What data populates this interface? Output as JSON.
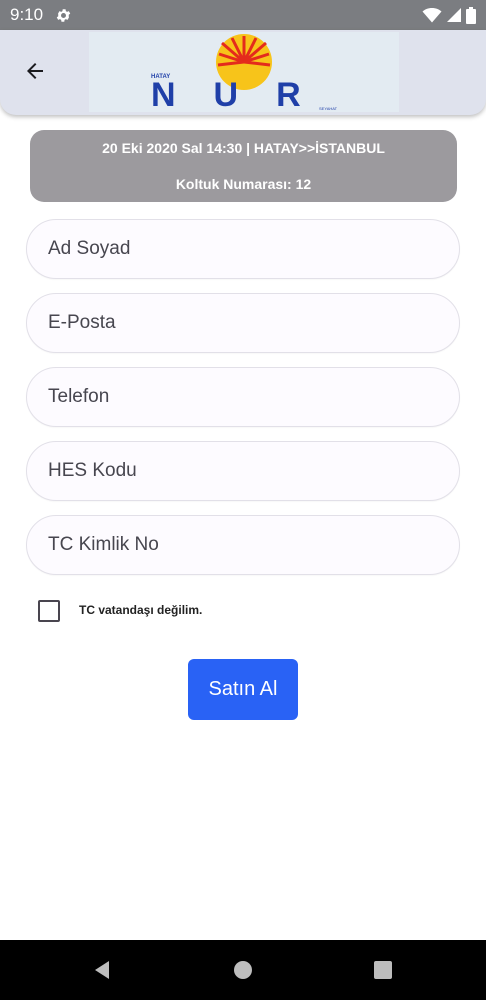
{
  "status_bar": {
    "time": "9:10",
    "icons": [
      "gear-icon",
      "wifi-icon",
      "signal-icon",
      "battery-icon"
    ]
  },
  "app_bar": {
    "back_icon": "arrow-left-icon",
    "logo": {
      "small_text_left": "HATAY",
      "brand": "NUR",
      "small_text_right": "SEYAHAT"
    }
  },
  "trip": {
    "line1": "20 Eki 2020 Sal 14:30 | HATAY>>İSTANBUL",
    "line2": "Koltuk Numarası: 12"
  },
  "form": {
    "name_placeholder": "Ad Soyad",
    "email_placeholder": "E-Posta",
    "phone_placeholder": "Telefon",
    "hes_placeholder": "HES Kodu",
    "tc_placeholder": "TC Kimlik No"
  },
  "checkbox": {
    "label": "TC vatandaşı değilim.",
    "checked": false
  },
  "buy_button": {
    "label": "Satın Al"
  },
  "colors": {
    "status_bar": "#7b7d81",
    "app_bar": "#dfe2ed",
    "trip_card": "#9c9a9e",
    "accent_button": "#2962f5",
    "logo_blue": "#1f3fa8",
    "logo_red": "#e42b1c",
    "logo_yellow": "#f7c41a"
  }
}
